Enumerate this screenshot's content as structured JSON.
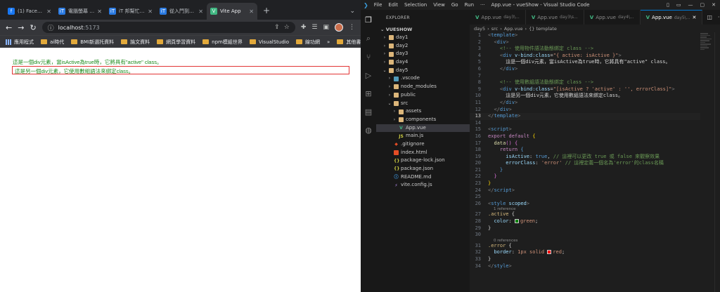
{
  "browser": {
    "tabs": [
      {
        "label": "(1) Facebook",
        "icon": "facebook-icon",
        "color": "#1877f2",
        "glyph": "f"
      },
      {
        "label": "電腦螢幕 - iT",
        "icon": "ithome-icon",
        "color": "#2a7ae2",
        "glyph": "iT"
      },
      {
        "label": "iT 邦幫忙 - 一",
        "icon": "ithome-icon",
        "color": "#2a7ae2",
        "glyph": "iT"
      },
      {
        "label": "從入門到入土",
        "icon": "ithome-icon",
        "color": "#2a7ae2",
        "glyph": "iT"
      },
      {
        "label": "Vite App",
        "icon": "vue-icon",
        "color": "#41b883",
        "glyph": "V"
      }
    ],
    "url_host": "localhost",
    "url_port": ":5173",
    "bookmarks": [
      "應用程式",
      "ai時代",
      "BMI新選托資料",
      "論文資料",
      "網頁學習資料",
      "npm模組世界",
      "VisualStudio",
      "線功網"
    ],
    "other_bookmarks": "其他書籤"
  },
  "page": {
    "line1": "這是一個div元素，當isActive為true時，它將具有\"active\" class。",
    "line2": "這是另一個div元素，它使用數組語法來綁定class。"
  },
  "vscode": {
    "logo": "❯",
    "menus": [
      "File",
      "Edit",
      "Selection",
      "View",
      "Go",
      "Run",
      "···"
    ],
    "window_title": "App.vue - vueShow - Visual Studio Code",
    "explorer_title": "EXPLORER",
    "root": "VUESHOW",
    "tree": [
      {
        "label": "day1",
        "depth": 1,
        "kind": "folder",
        "chev": "›"
      },
      {
        "label": "day2",
        "depth": 1,
        "kind": "folder",
        "chev": "›"
      },
      {
        "label": "day3",
        "depth": 1,
        "kind": "folder",
        "chev": "›"
      },
      {
        "label": "day4",
        "depth": 1,
        "kind": "folder",
        "chev": "›"
      },
      {
        "label": "day5",
        "depth": 1,
        "kind": "folder",
        "chev": "⌄"
      },
      {
        "label": ".vscode",
        "depth": 2,
        "kind": "folder-blue",
        "chev": "›"
      },
      {
        "label": "node_modules",
        "depth": 2,
        "kind": "folder",
        "chev": "›"
      },
      {
        "label": "public",
        "depth": 2,
        "kind": "folder",
        "chev": "›"
      },
      {
        "label": "src",
        "depth": 2,
        "kind": "folder",
        "chev": "⌄"
      },
      {
        "label": "assets",
        "depth": 3,
        "kind": "folder",
        "chev": "›"
      },
      {
        "label": "components",
        "depth": 3,
        "kind": "folder",
        "chev": "›"
      },
      {
        "label": "App.vue",
        "depth": 3,
        "kind": "vue",
        "chev": "",
        "active": true
      },
      {
        "label": "main.js",
        "depth": 3,
        "kind": "js",
        "chev": ""
      },
      {
        "label": ".gitignore",
        "depth": 2,
        "kind": "git",
        "chev": ""
      },
      {
        "label": "index.html",
        "depth": 2,
        "kind": "html",
        "chev": ""
      },
      {
        "label": "package-lock.json",
        "depth": 2,
        "kind": "json",
        "chev": ""
      },
      {
        "label": "package.json",
        "depth": 2,
        "kind": "json",
        "chev": ""
      },
      {
        "label": "README.md",
        "depth": 2,
        "kind": "md",
        "chev": ""
      },
      {
        "label": "vite.config.js",
        "depth": 2,
        "kind": "vite",
        "chev": ""
      }
    ],
    "editor_tabs": [
      {
        "label": "App.vue",
        "desc": "day3\\...",
        "active": false
      },
      {
        "label": "App.vue",
        "desc": "day3\\s...",
        "active": false
      },
      {
        "label": "App.vue",
        "desc": "day4\\...",
        "active": false
      },
      {
        "label": "App.vue",
        "desc": "day5\\...",
        "active": true
      }
    ],
    "breadcrumb": [
      "day5",
      "src",
      "App.vue",
      "{} template"
    ],
    "current_line": 13,
    "code": [
      {
        "n": 1,
        "seg": [
          [
            "t-br",
            "<"
          ],
          [
            "t-tag",
            "template"
          ],
          [
            "t-br",
            ">"
          ]
        ]
      },
      {
        "n": 2,
        "seg": [
          [
            "t-txt",
            "  "
          ],
          [
            "t-br",
            "<"
          ],
          [
            "t-tag",
            "div"
          ],
          [
            "t-br",
            ">"
          ]
        ]
      },
      {
        "n": 3,
        "seg": [
          [
            "t-txt",
            "    "
          ],
          [
            "t-com",
            "<!-- 使用物件語法動態綁定 class -->"
          ]
        ]
      },
      {
        "n": 4,
        "seg": [
          [
            "t-txt",
            "    "
          ],
          [
            "t-br",
            "<"
          ],
          [
            "t-tag",
            "div"
          ],
          [
            "t-txt",
            " "
          ],
          [
            "t-attr",
            "v-bind:class"
          ],
          [
            "t-txt",
            "="
          ],
          [
            "t-str",
            "\"{ active: isActive }\""
          ],
          [
            "t-br",
            ">"
          ]
        ]
      },
      {
        "n": 5,
        "seg": [
          [
            "t-txt",
            "      這是一個div元素，當isActive為true時，它將具有\"active\" class。"
          ]
        ]
      },
      {
        "n": 6,
        "seg": [
          [
            "t-txt",
            "    "
          ],
          [
            "t-br",
            "</"
          ],
          [
            "t-tag",
            "div"
          ],
          [
            "t-br",
            ">"
          ]
        ]
      },
      {
        "n": 7,
        "seg": [
          [
            "t-txt",
            ""
          ]
        ]
      },
      {
        "n": 8,
        "seg": [
          [
            "t-txt",
            "    "
          ],
          [
            "t-com",
            "<!-- 使用數組語法動態綁定 class -->"
          ]
        ]
      },
      {
        "n": 9,
        "seg": [
          [
            "t-txt",
            "    "
          ],
          [
            "t-br",
            "<"
          ],
          [
            "t-tag",
            "div"
          ],
          [
            "t-txt",
            " "
          ],
          [
            "t-attr",
            "v-bind:class"
          ],
          [
            "t-txt",
            "="
          ],
          [
            "t-str",
            "\"[isActive ? 'active' : '', errorClass]\""
          ],
          [
            "t-br",
            ">"
          ]
        ]
      },
      {
        "n": 10,
        "seg": [
          [
            "t-txt",
            "      這是另一個div元素，它使用數組語法來綁定class。"
          ]
        ]
      },
      {
        "n": 11,
        "seg": [
          [
            "t-txt",
            "    "
          ],
          [
            "t-br",
            "</"
          ],
          [
            "t-tag",
            "div"
          ],
          [
            "t-br",
            ">"
          ]
        ]
      },
      {
        "n": 12,
        "seg": [
          [
            "t-txt",
            "  "
          ],
          [
            "t-br",
            "</"
          ],
          [
            "t-tag",
            "div"
          ],
          [
            "t-br",
            ">"
          ]
        ]
      },
      {
        "n": 13,
        "seg": [
          [
            "t-br",
            "</"
          ],
          [
            "t-tag",
            "template"
          ],
          [
            "t-br",
            ">"
          ]
        ]
      },
      {
        "n": 14,
        "seg": [
          [
            "t-txt",
            ""
          ]
        ]
      },
      {
        "n": 15,
        "seg": [
          [
            "t-br",
            "<"
          ],
          [
            "t-tag",
            "script"
          ],
          [
            "t-br",
            ">"
          ]
        ]
      },
      {
        "n": 16,
        "seg": [
          [
            "t-kw",
            "export default"
          ],
          [
            "t-txt",
            " "
          ],
          [
            "t-y",
            "{"
          ]
        ]
      },
      {
        "n": 17,
        "seg": [
          [
            "t-txt",
            "  "
          ],
          [
            "t-fn",
            "data"
          ],
          [
            "t-p",
            "()"
          ],
          [
            "t-txt",
            " "
          ],
          [
            "t-p",
            "{"
          ]
        ]
      },
      {
        "n": 18,
        "seg": [
          [
            "t-txt",
            "    "
          ],
          [
            "t-kw",
            "return"
          ],
          [
            "t-txt",
            " "
          ],
          [
            "t-bool",
            "{"
          ]
        ]
      },
      {
        "n": 19,
        "seg": [
          [
            "t-txt",
            "      "
          ],
          [
            "t-prop",
            "isActive"
          ],
          [
            "t-txt",
            ": "
          ],
          [
            "t-bool",
            "true"
          ],
          [
            "t-txt",
            ", "
          ],
          [
            "t-com",
            "// 這裡可以更改 true 或 false 來觀察效果"
          ]
        ]
      },
      {
        "n": 20,
        "seg": [
          [
            "t-txt",
            "      "
          ],
          [
            "t-prop",
            "errorClass"
          ],
          [
            "t-txt",
            ": "
          ],
          [
            "t-str",
            "'error'"
          ],
          [
            "t-txt",
            " "
          ],
          [
            "t-com",
            "// 這裡定義一個名為'error'的class名稱"
          ]
        ]
      },
      {
        "n": 21,
        "seg": [
          [
            "t-txt",
            "    "
          ],
          [
            "t-bool",
            "}"
          ]
        ]
      },
      {
        "n": 22,
        "seg": [
          [
            "t-txt",
            "  "
          ],
          [
            "t-p",
            "}"
          ]
        ]
      },
      {
        "n": 23,
        "seg": [
          [
            "t-y",
            "}"
          ]
        ]
      },
      {
        "n": 24,
        "seg": [
          [
            "t-br",
            "</"
          ],
          [
            "t-tag",
            "script"
          ],
          [
            "t-br",
            ">"
          ]
        ]
      },
      {
        "n": 25,
        "seg": [
          [
            "t-txt",
            ""
          ]
        ]
      },
      {
        "n": 26,
        "seg": [
          [
            "t-br",
            "<"
          ],
          [
            "t-tag",
            "style"
          ],
          [
            "t-txt",
            " "
          ],
          [
            "t-attr",
            "scoped"
          ],
          [
            "t-br",
            ">"
          ]
        ],
        "lens_after": "1 reference"
      },
      {
        "n": 27,
        "seg": [
          [
            "t-sel",
            ".active"
          ],
          [
            "t-txt",
            " {"
          ]
        ]
      },
      {
        "n": 28,
        "seg": [
          [
            "t-txt",
            "  "
          ],
          [
            "t-prop",
            "color"
          ],
          [
            "t-txt",
            ": "
          ],
          [
            "sw-green",
            ""
          ],
          [
            "t-str",
            "green"
          ],
          [
            "t-txt",
            ";"
          ]
        ]
      },
      {
        "n": 29,
        "seg": [
          [
            "t-txt",
            "}"
          ]
        ]
      },
      {
        "n": 30,
        "seg": [
          [
            "t-txt",
            ""
          ]
        ],
        "lens_after": "0 references"
      },
      {
        "n": 31,
        "seg": [
          [
            "t-sel",
            ".error"
          ],
          [
            "t-txt",
            " {"
          ]
        ]
      },
      {
        "n": 32,
        "seg": [
          [
            "t-txt",
            "  "
          ],
          [
            "t-prop",
            "border"
          ],
          [
            "t-txt",
            ": "
          ],
          [
            "t-str",
            "1px solid "
          ],
          [
            "sw-red",
            ""
          ],
          [
            "t-str",
            "red"
          ],
          [
            "t-txt",
            ";"
          ]
        ]
      },
      {
        "n": 33,
        "seg": [
          [
            "t-txt",
            "}"
          ]
        ]
      },
      {
        "n": 34,
        "seg": [
          [
            "t-br",
            "</"
          ],
          [
            "t-tag",
            "style"
          ],
          [
            "t-br",
            ">"
          ]
        ]
      }
    ]
  }
}
